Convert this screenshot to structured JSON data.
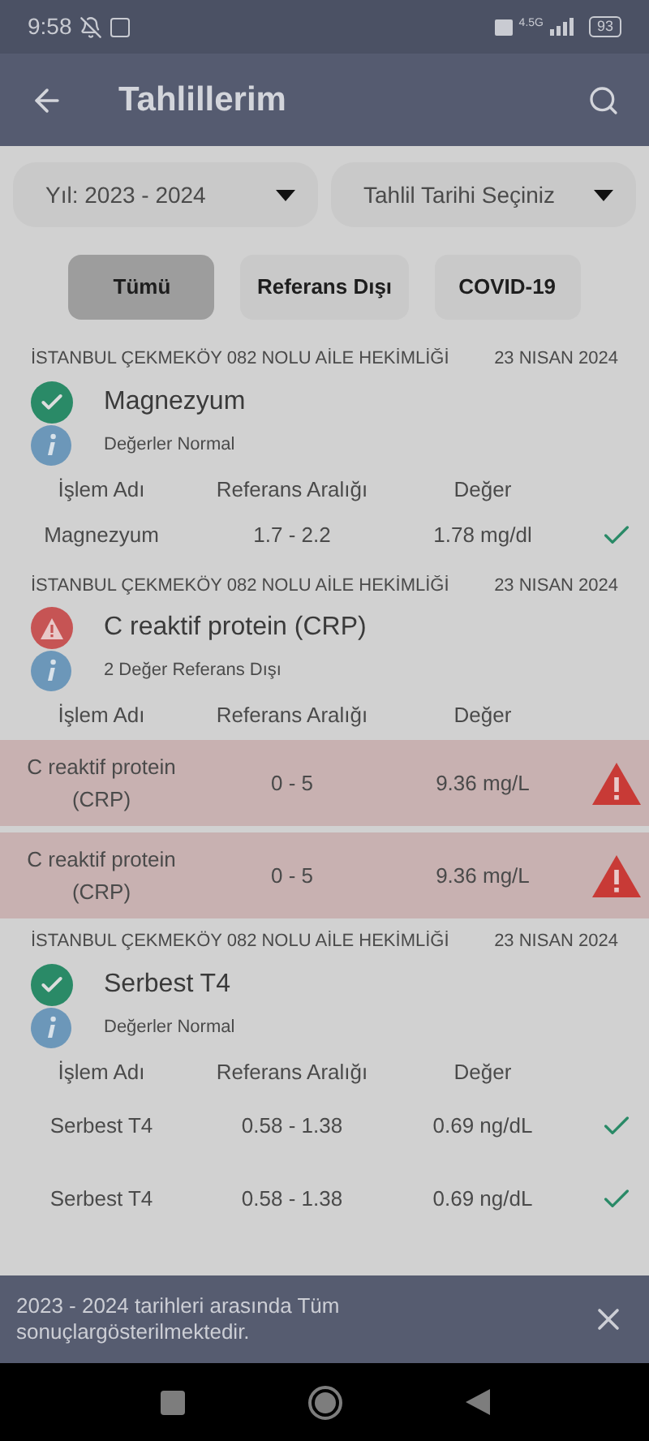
{
  "status_bar": {
    "time": "9:58",
    "network": "4.5G",
    "battery": "93"
  },
  "app_bar": {
    "title": "Tahlillerim"
  },
  "filters": [
    {
      "label": "Yıl: 2023 - 2024"
    },
    {
      "label": "Tahlil Tarihi Seçiniz"
    }
  ],
  "tabs": [
    {
      "label": "Tümü",
      "selected": true
    },
    {
      "label": "Referans Dışı",
      "selected": false
    },
    {
      "label": "COVID-19",
      "selected": false
    }
  ],
  "results": [
    {
      "clinic": "İSTANBUL ÇEKMEKÖY 082 NOLU AİLE HEKİMLİĞİ",
      "date": "23 NISAN 2024",
      "kind": "normal",
      "title": "Magnezyum",
      "summary": "Değerler Normal",
      "columns": [
        "İşlem Adı",
        "Referans Aralığı",
        "Değer"
      ],
      "rows": [
        {
          "name": "Magnezyum",
          "range": "1.7 - 2.2",
          "value": "1.78 mg/dl",
          "out_of_range": false
        }
      ]
    },
    {
      "clinic": "İSTANBUL ÇEKMEKÖY 082 NOLU AİLE HEKİMLİĞİ",
      "date": "23 NISAN 2024",
      "kind": "abnormal",
      "title": "C reaktif protein (CRP)",
      "summary": "2 Değer Referans Dışı",
      "columns": [
        "İşlem Adı",
        "Referans Aralığı",
        "Değer"
      ],
      "rows": [
        {
          "name": "C reaktif protein (CRP)",
          "range": "0 - 5",
          "value": "9.36 mg/L",
          "out_of_range": true
        },
        {
          "name": "C reaktif protein (CRP)",
          "range": "0 - 5",
          "value": "9.36 mg/L",
          "out_of_range": true
        }
      ]
    },
    {
      "clinic": "İSTANBUL ÇEKMEKÖY 082 NOLU AİLE HEKİMLİĞİ",
      "date": "23 NISAN 2024",
      "kind": "normal",
      "title": "Serbest T4",
      "summary": "Değerler Normal",
      "columns": [
        "İşlem Adı",
        "Referans Aralığı",
        "Değer"
      ],
      "rows": [
        {
          "name": "Serbest T4",
          "range": "0.58 - 1.38",
          "value": "0.69 ng/dL",
          "out_of_range": false
        },
        {
          "name": "Serbest T4",
          "range": "0.58 - 1.38",
          "value": "0.69 ng/dL",
          "out_of_range": false
        }
      ]
    }
  ],
  "snackbar": {
    "message": "2023 - 2024 tarihleri arasında Tüm sonuçlargösterilmektedir."
  }
}
